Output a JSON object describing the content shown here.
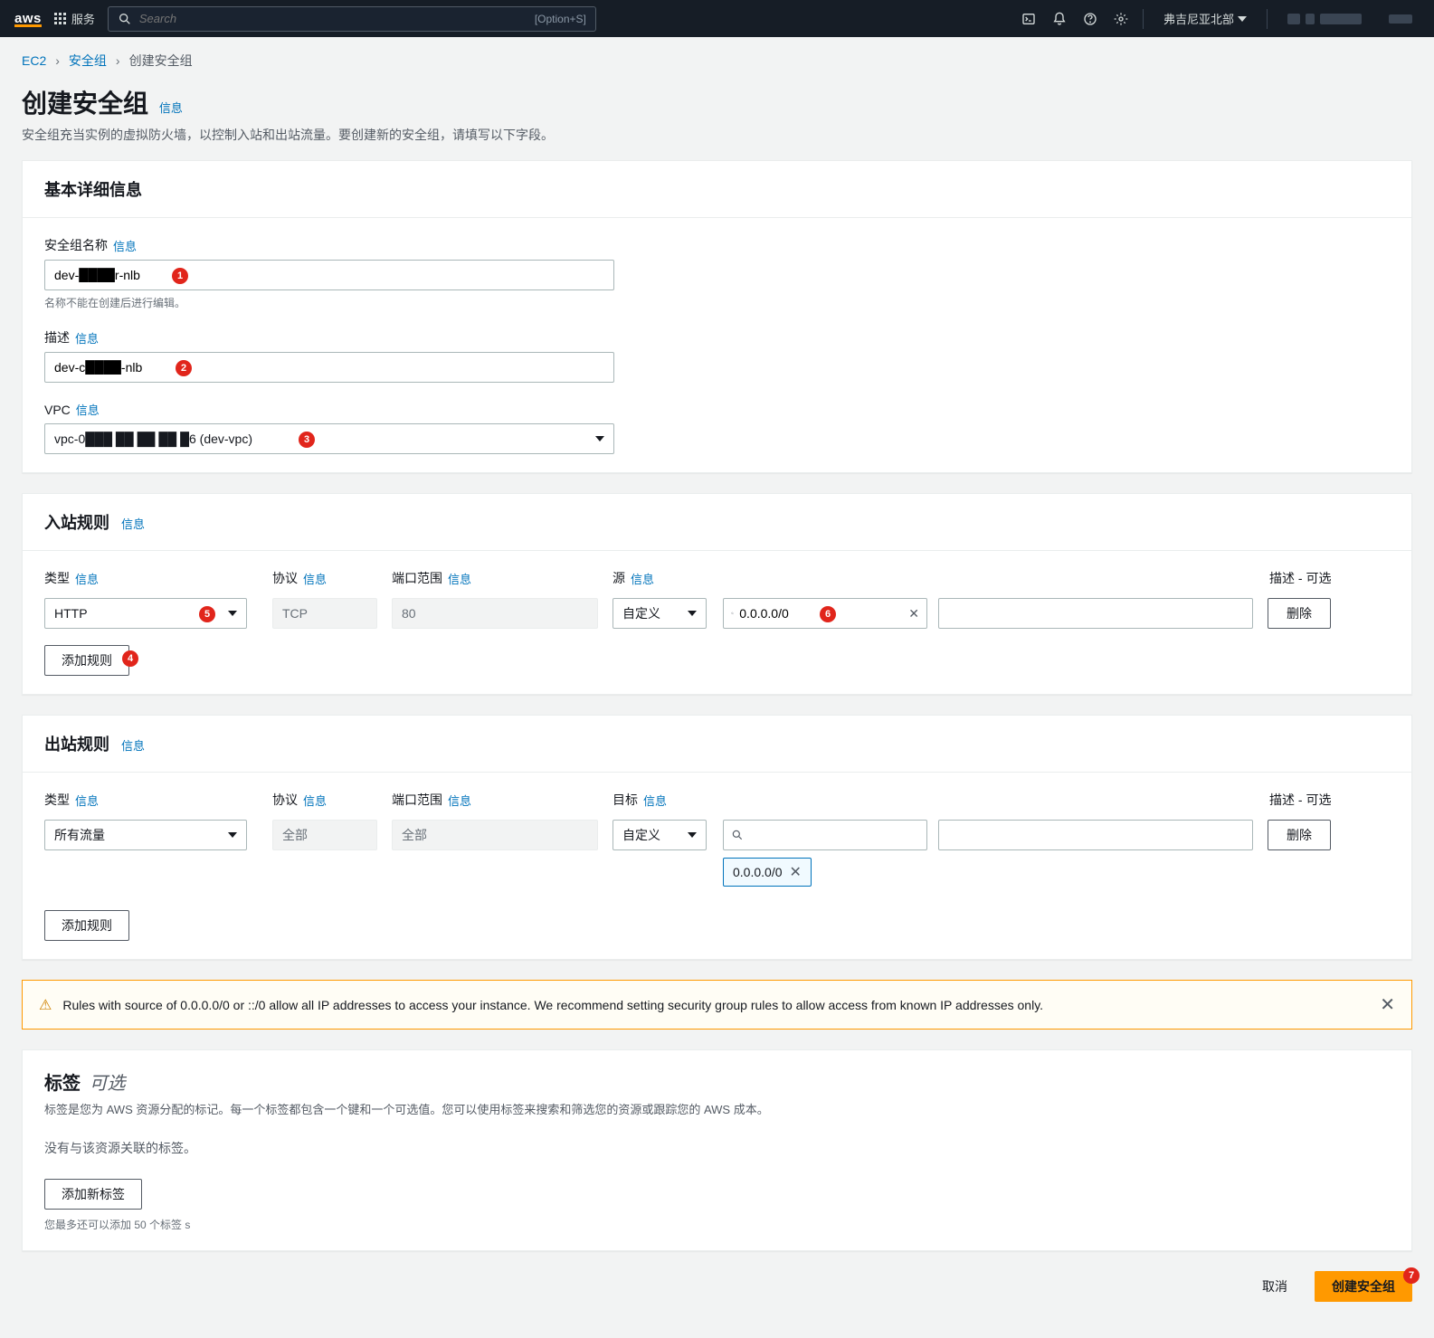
{
  "nav": {
    "services": "服务",
    "search_placeholder": "Search",
    "search_hint": "[Option+S]",
    "region": "弗吉尼亚北部"
  },
  "breadcrumb": {
    "items": [
      "EC2",
      "安全组",
      "创建安全组"
    ]
  },
  "page": {
    "title": "创建安全组",
    "info": "信息",
    "subtitle": "安全组充当实例的虚拟防火墙，以控制入站和出站流量。要创建新的安全组，请填写以下字段。"
  },
  "basic": {
    "header": "基本详细信息",
    "name_label": "安全组名称",
    "name_value": "dev-████r-nlb",
    "name_hint": "名称不能在创建后进行编辑。",
    "desc_label": "描述",
    "desc_value": "dev-c████-nlb",
    "vpc_label": "VPC",
    "vpc_value": "vpc-0███ ██ ██ ██ █6 (dev-vpc)"
  },
  "common": {
    "info": "信息",
    "type": "类型",
    "protocol": "协议",
    "port_range": "端口范围",
    "source": "源",
    "destination": "目标",
    "desc_optional": "描述 - 可选",
    "delete": "删除",
    "add_rule": "添加规则",
    "custom": "自定义"
  },
  "inbound": {
    "header": "入站规则",
    "rules": [
      {
        "type": "HTTP",
        "protocol": "TCP",
        "port": "80",
        "source_mode": "自定义",
        "source_value": "0.0.0.0/0",
        "description": ""
      }
    ]
  },
  "outbound": {
    "header": "出站规则",
    "rules": [
      {
        "type": "所有流量",
        "protocol": "全部",
        "port": "全部",
        "dest_mode": "自定义",
        "dest_value": "",
        "dest_chip": "0.0.0.0/0",
        "description": ""
      }
    ]
  },
  "alert": {
    "text": "Rules with source of 0.0.0.0/0 or ::/0 allow all IP addresses to access your instance. We recommend setting security group rules to allow access from known IP addresses only."
  },
  "tags": {
    "header": "标签",
    "optional": "可选",
    "desc": "标签是您为 AWS 资源分配的标记。每一个标签都包含一个键和一个可选值。您可以使用标签来搜索和筛选您的资源或跟踪您的 AWS 成本。",
    "none": "没有与该资源关联的标签。",
    "add": "添加新标签",
    "limit": "您最多还可以添加 50 个标签 s"
  },
  "footer": {
    "cancel": "取消",
    "submit": "创建安全组"
  },
  "annotations": [
    "1",
    "2",
    "3",
    "4",
    "5",
    "6",
    "7"
  ]
}
